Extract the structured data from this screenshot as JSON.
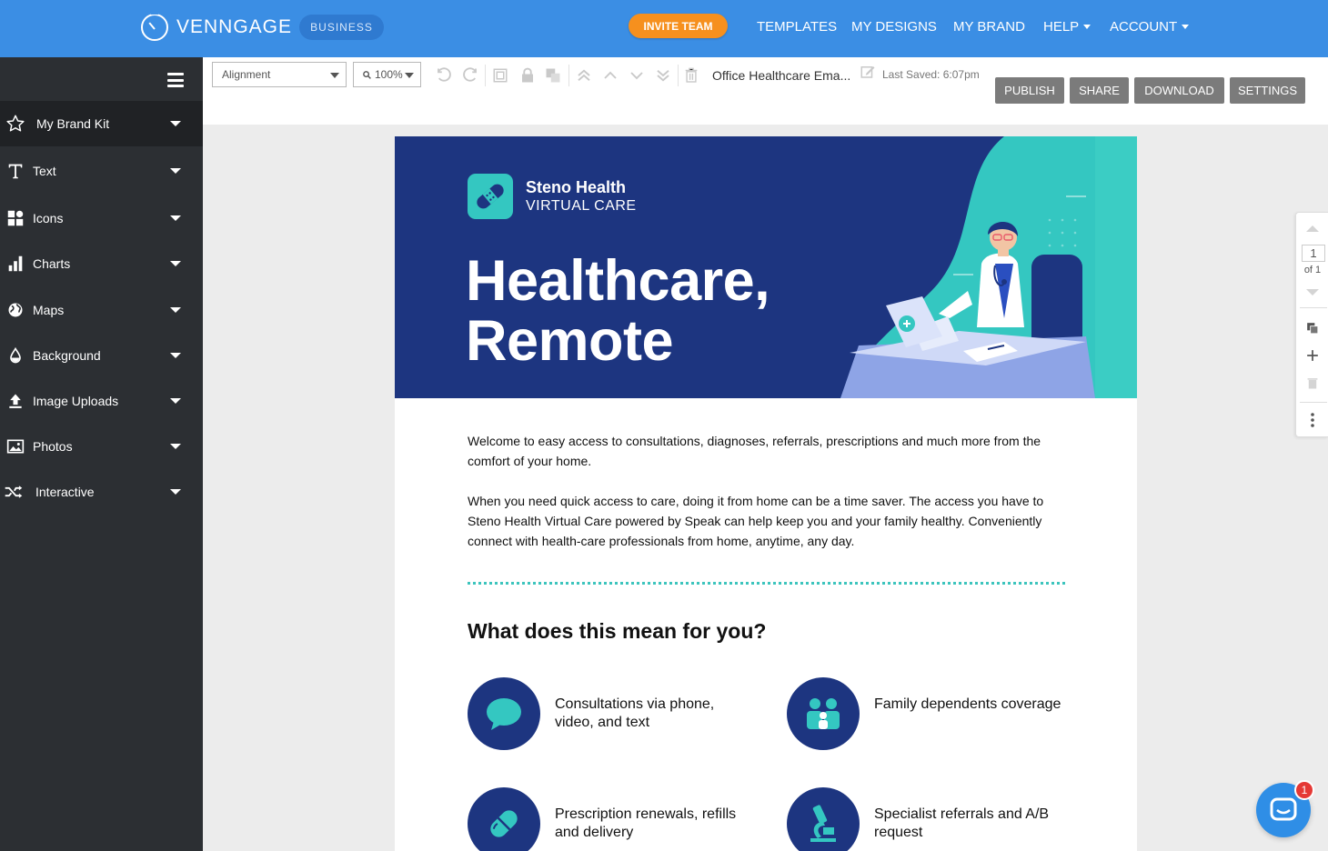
{
  "colors": {
    "topbar": "#3b8ee4",
    "sidebar": "#2c2f33",
    "accent_orange": "#f6901e",
    "hero_navy": "#1d3580",
    "hero_teal": "#34c7c1",
    "action_gray": "#7b7b7b"
  },
  "header": {
    "logo_text": "VENNGAGE",
    "badge": "BUSINESS",
    "invite_label": "INVITE TEAM",
    "nav": {
      "templates": "TEMPLATES",
      "my_designs": "MY DESIGNS",
      "my_brand": "MY BRAND",
      "help": "HELP",
      "account": "ACCOUNT"
    }
  },
  "sidebar": {
    "items": [
      {
        "label": "My Brand Kit",
        "icon": "star-icon"
      },
      {
        "label": "Text",
        "icon": "text-icon"
      },
      {
        "label": "Icons",
        "icon": "icons-grid-icon"
      },
      {
        "label": "Charts",
        "icon": "bar-chart-icon"
      },
      {
        "label": "Maps",
        "icon": "globe-icon"
      },
      {
        "label": "Background",
        "icon": "drop-icon"
      },
      {
        "label": "Image Uploads",
        "icon": "upload-icon"
      },
      {
        "label": "Photos",
        "icon": "image-icon"
      },
      {
        "label": "Interactive",
        "icon": "shuffle-icon"
      }
    ]
  },
  "toolbar": {
    "alignment": "Alignment",
    "zoom": "100%",
    "doc_title": "Office Healthcare Ema...",
    "last_saved": "Last Saved: 6:07pm",
    "publish": "PUBLISH",
    "share": "SHARE",
    "download": "DOWNLOAD",
    "settings": "SETTINGS"
  },
  "design": {
    "brand_name": "Steno Health",
    "brand_sub": "VIRTUAL CARE",
    "hero_line1": "Healthcare,",
    "hero_line2": "Remote",
    "para1": "Welcome to easy access to consultations, diagnoses, referrals, prescriptions and much more from the comfort of your home.",
    "para2": "When you need quick access to care, doing it from home can be a time saver. The access you have to Steno Health Virtual Care powered by Speak can help keep you and your family healthy. Conveniently connect with health-care professionals from home, anytime, any day.",
    "section_title": "What does this mean for you?",
    "features": [
      {
        "text": "Consultations via phone, video, and text",
        "icon": "chat-bubble-icon"
      },
      {
        "text": "Family dependents coverage",
        "icon": "family-icon"
      },
      {
        "text": "Prescription renewals, refills and delivery",
        "icon": "pill-icon"
      },
      {
        "text": "Specialist referrals and A/B request",
        "icon": "microscope-icon"
      }
    ]
  },
  "page_panel": {
    "current": "1",
    "of": "of 1"
  },
  "chat": {
    "badge": "1"
  }
}
